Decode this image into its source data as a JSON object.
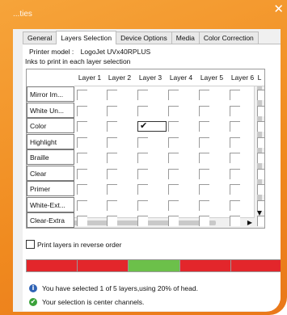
{
  "window": {
    "title": "...ties"
  },
  "tabs": [
    {
      "label": "General"
    },
    {
      "label": "Layers Selection",
      "active": true
    },
    {
      "label": "Device Options"
    },
    {
      "label": "Media"
    },
    {
      "label": "Color Correction"
    }
  ],
  "printer": {
    "label": "Printer model :",
    "value": "LogoJet UVx40RPLUS"
  },
  "group_label": "Inks to print in each layer selection",
  "grid": {
    "columns": [
      "Layer 1",
      "Layer 2",
      "Layer 3",
      "Layer 4",
      "Layer 5",
      "Layer 6",
      "L"
    ],
    "rows": [
      {
        "label": "Mirror Im...",
        "checked": []
      },
      {
        "label": "White Un...",
        "checked": []
      },
      {
        "label": "Color",
        "checked": [
          2
        ]
      },
      {
        "label": "Highlight",
        "checked": []
      },
      {
        "label": "Braille",
        "checked": []
      },
      {
        "label": "Clear",
        "checked": []
      },
      {
        "label": "Primer",
        "checked": []
      },
      {
        "label": "White-Ext...",
        "checked": []
      },
      {
        "label": "Clear-Extra",
        "checked": []
      },
      {
        "label": "",
        "checked": []
      }
    ],
    "check_glyph": "✔"
  },
  "reverse_order": {
    "label": "Print layers in reverse order",
    "checked": false
  },
  "head_bar": {
    "segments": [
      "red",
      "red",
      "green",
      "red",
      "red"
    ],
    "colors": {
      "red": "#e3262b",
      "green": "#6cc04a"
    }
  },
  "messages": [
    {
      "icon": "info-icon",
      "glyph": "i",
      "color": "#2f63b5",
      "text": "You have selected 1 of 5 layers,using 20% of head."
    },
    {
      "icon": "check-circle-icon",
      "glyph": "✔",
      "color": "#3aa23a",
      "text": "Your selection is center channels."
    }
  ],
  "theme": {
    "accent": "#f08a1f"
  }
}
